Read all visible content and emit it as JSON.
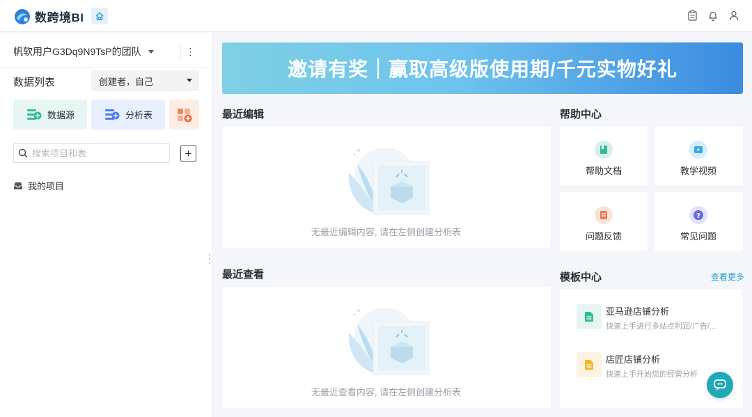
{
  "header": {
    "logo_text": "数跨境BI"
  },
  "sidebar": {
    "team_name": "帆软用户G3Dq9N9TsP的团队",
    "more_glyph": "⋮",
    "list_title": "数据列表",
    "creator_filter": "创建者，自己",
    "quick_create": {
      "datasource_label": "数据源",
      "analysis_label": "分析表"
    },
    "search": {
      "placeholder": "搜索项目和表"
    },
    "add_glyph": "+",
    "my_project_label": "我的项目"
  },
  "banner": {
    "text": "邀请有奖｜赢取高级版使用期/千元实物好礼"
  },
  "recent_edit": {
    "title": "最近编辑",
    "empty_text": "无最近编辑内容, 请在左侧创建分析表"
  },
  "recent_view": {
    "title": "最近查看",
    "empty_text": "无最近查看内容, 请在左侧创建分析表"
  },
  "help_center": {
    "title": "帮助中心",
    "items": [
      {
        "label": "帮助文档"
      },
      {
        "label": "教学视频"
      },
      {
        "label": "问题反馈"
      },
      {
        "label": "常见问题"
      }
    ]
  },
  "templates": {
    "title": "模板中心",
    "more_label": "查看更多",
    "items": [
      {
        "name": "亚马逊店铺分析",
        "desc": "快速上手进行多站点利润/广告/..."
      },
      {
        "name": "店匠店铺分析",
        "desc": "快速上手开始您的经营分析"
      }
    ]
  },
  "colors": {
    "accent": "#20a9b8",
    "link": "#2a9fd6",
    "banner_start": "#7fd0e4",
    "banner_end": "#3b8be0"
  }
}
